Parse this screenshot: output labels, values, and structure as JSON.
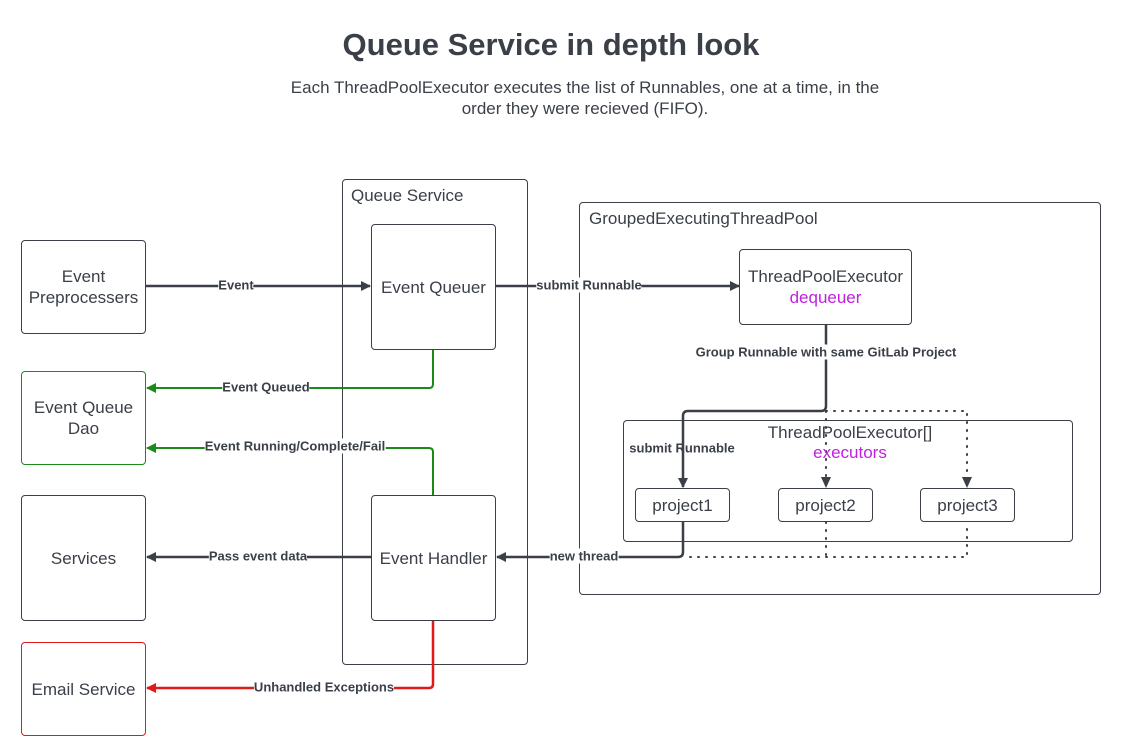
{
  "header": {
    "title": "Queue Service in depth look",
    "subtitle": "Each ThreadPoolExecutor executes the list of Runnables, one at a time, in the order they were recieved (FIFO)."
  },
  "containers": {
    "queue_service": "Queue Service",
    "grouped_pool": "GroupedExecutingThreadPool",
    "executors_array": {
      "name": "ThreadPoolExecutor[]",
      "var": "executors"
    }
  },
  "nodes": {
    "event_preprocessers": "Event Preprocessers",
    "event_queue_dao": "Event Queue Dao",
    "services": "Services",
    "email_service": "Email Service",
    "event_queuer": "Event Queuer",
    "event_handler": "Event Handler",
    "dequeuer": {
      "name": "ThreadPoolExecutor",
      "var": "dequeuer"
    },
    "projects": [
      "project1",
      "project2",
      "project3"
    ]
  },
  "edges": {
    "event": "Event",
    "submit_runnable_main": "submit Runnable",
    "event_queued": "Event Queued",
    "event_status": "Event Running/Complete/Fail",
    "group_runnable": "Group Runnable with same GitLab Project",
    "submit_runnable_project": "submit Runnable",
    "pass_event_data": "Pass event data",
    "new_thread": "new thread",
    "unhandled_exceptions": "Unhandled Exceptions"
  },
  "colors": {
    "line": "#3a3f48",
    "success": "#1a8a1a",
    "error": "#e01919",
    "variable": "#c020e0"
  }
}
